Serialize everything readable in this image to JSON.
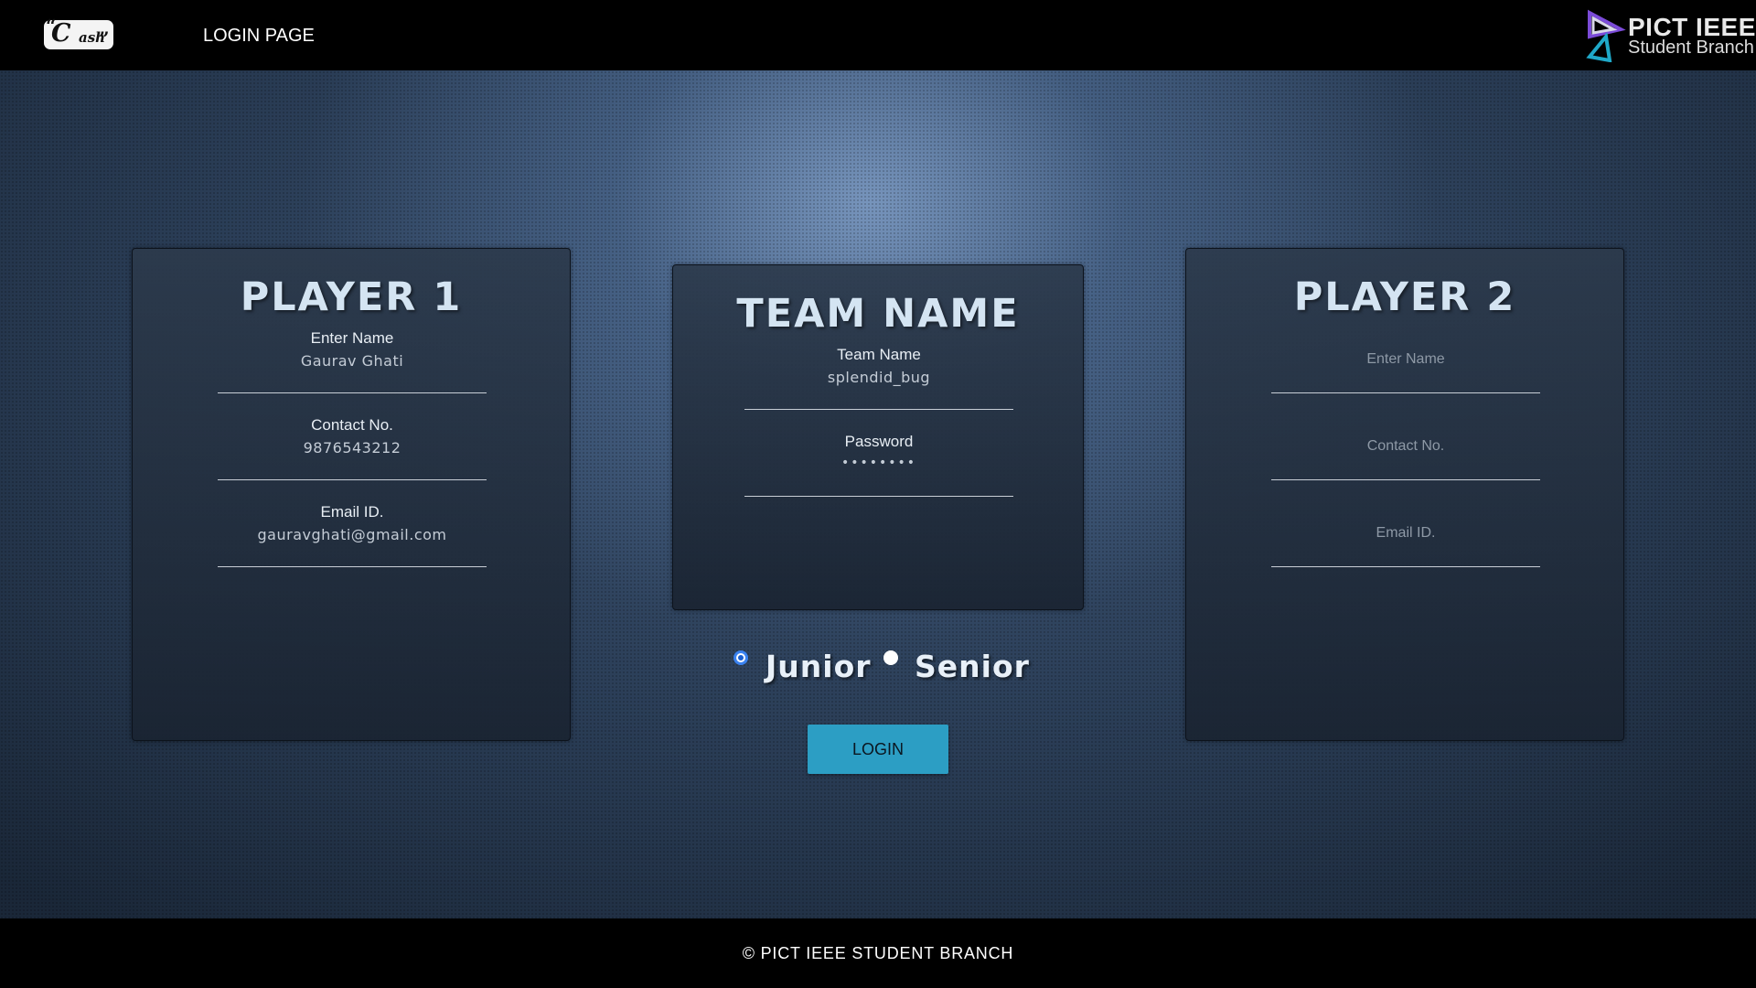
{
  "header": {
    "logo_big": "C",
    "logo_small": "ash",
    "logo_quote_open": "“",
    "logo_quote_close": "”",
    "nav_title": "LOGIN PAGE",
    "branch_logo": {
      "name": "PICT IEEE",
      "sub": "Student Branch"
    }
  },
  "player1": {
    "title": "PLAYER 1",
    "fields": [
      {
        "label": "Enter Name",
        "value": "Gaurav Ghati"
      },
      {
        "label": "Contact No.",
        "value": "9876543212"
      },
      {
        "label": "Email ID.",
        "value": "gauravghati@gmail.com"
      }
    ]
  },
  "team": {
    "title": "TEAM NAME",
    "name_label": "Team Name",
    "name_value": "splendid_bug",
    "password_label": "Password",
    "password_value": "••••••••"
  },
  "player2": {
    "title": "PLAYER 2",
    "placeholders": [
      "Enter Name",
      "Contact No.",
      "Email ID."
    ]
  },
  "category": {
    "options": [
      "Junior",
      "Senior"
    ],
    "selected": "Junior"
  },
  "login_label": "LOGIN",
  "footer": {
    "text": "© PICT IEEE STUDENT BRANCH"
  },
  "colors": {
    "accent_button": "#2c9ec4",
    "radio_selected": "#3a82f0",
    "title_text": "#d4e4f2"
  }
}
